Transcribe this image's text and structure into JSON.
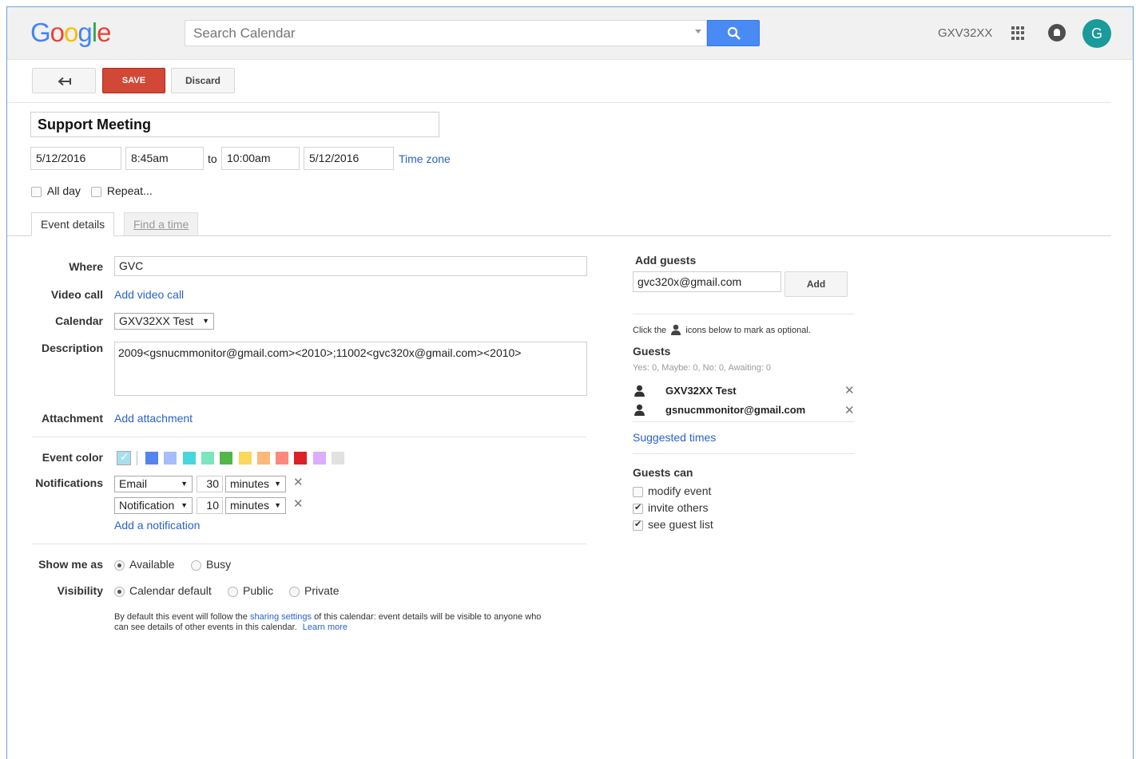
{
  "header": {
    "logo_letters": [
      {
        "ch": "G",
        "color": "#4285f4"
      },
      {
        "ch": "o",
        "color": "#ea4335"
      },
      {
        "ch": "o",
        "color": "#fbbc05"
      },
      {
        "ch": "g",
        "color": "#4285f4"
      },
      {
        "ch": "l",
        "color": "#34a853"
      },
      {
        "ch": "e",
        "color": "#ea4335"
      }
    ],
    "search_placeholder": "Search Calendar",
    "account_name": "GXV32XX",
    "avatar_letter": "G"
  },
  "toolbar": {
    "save_label": "SAVE",
    "discard_label": "Discard"
  },
  "event": {
    "title": "Support Meeting",
    "start_date": "5/12/2016",
    "start_time": "8:45am",
    "to_label": "to",
    "end_time": "10:00am",
    "end_date": "5/12/2016",
    "time_zone_link": "Time zone",
    "all_day_label": "All day",
    "repeat_label": "Repeat..."
  },
  "tabs": {
    "event_details": "Event details",
    "find_a_time": "Find a time"
  },
  "details": {
    "where_label": "Where",
    "where_value": "GVC",
    "video_call_label": "Video call",
    "add_video_call": "Add video call",
    "calendar_label": "Calendar",
    "calendar_value": "GXV32XX Test",
    "description_label": "Description",
    "description_value": "2009<gsnucmmonitor@gmail.com><2010>;11002<gvc320x@gmail.com><2010>",
    "attachment_label": "Attachment",
    "add_attachment": "Add attachment",
    "event_color_label": "Event color",
    "colors": [
      "#5484ed",
      "#a4bdfc",
      "#46d6db",
      "#7ae7bf",
      "#51b749",
      "#fbd75b",
      "#ffb878",
      "#ff887c",
      "#dc2127",
      "#dbadff",
      "#e1e1e1"
    ],
    "notifications_label": "Notifications",
    "notifications": [
      {
        "method": "Email",
        "amount": "30",
        "unit": "minutes"
      },
      {
        "method": "Notification",
        "amount": "10",
        "unit": "minutes"
      }
    ],
    "add_notification": "Add a notification",
    "show_me_as_label": "Show me as",
    "show_me_as_options": [
      "Available",
      "Busy"
    ],
    "visibility_label": "Visibility",
    "visibility_options": [
      "Calendar default",
      "Public",
      "Private"
    ],
    "visibility_note_1": "By default this event will follow the",
    "visibility_note_link": "sharing settings",
    "visibility_note_2": "of this calendar: event details will be visible to anyone who",
    "visibility_note_3": "can see details of other events in this calendar.",
    "learn_more": "Learn more"
  },
  "guests": {
    "add_guests_label": "Add guests",
    "guest_input_value": "gvc320x@gmail.com",
    "add_button": "Add",
    "optional_hint_1": "Click the",
    "optional_hint_2": "icons below to mark as optional.",
    "guests_heading": "Guests",
    "rsvp_summary": "Yes: 0, Maybe: 0, No: 0, Awaiting: 0",
    "list": [
      "GXV32XX Test",
      "gsnucmmonitor@gmail.com"
    ],
    "suggested_times": "Suggested times",
    "guests_can_heading": "Guests can",
    "permissions": [
      {
        "label": "modify event",
        "checked": false
      },
      {
        "label": "invite others",
        "checked": true
      },
      {
        "label": "see guest list",
        "checked": true
      }
    ]
  }
}
